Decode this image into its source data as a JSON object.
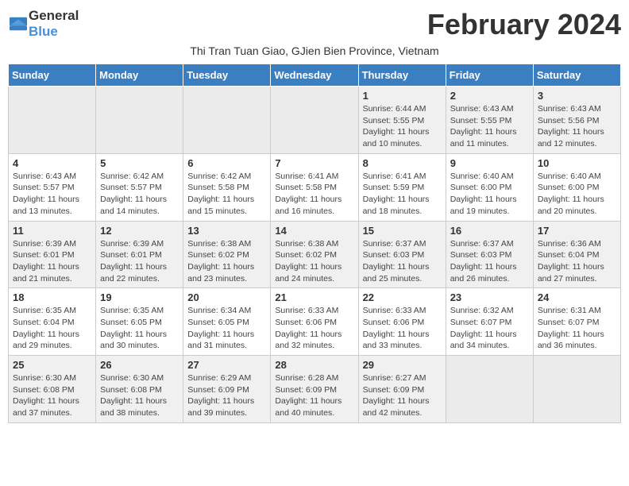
{
  "header": {
    "logo_general": "General",
    "logo_blue": "Blue",
    "title": "February 2024",
    "subtitle": "Thi Tran Tuan Giao, GJien Bien Province, Vietnam"
  },
  "days_of_week": [
    "Sunday",
    "Monday",
    "Tuesday",
    "Wednesday",
    "Thursday",
    "Friday",
    "Saturday"
  ],
  "weeks": [
    [
      {
        "day": "",
        "info": ""
      },
      {
        "day": "",
        "info": ""
      },
      {
        "day": "",
        "info": ""
      },
      {
        "day": "",
        "info": ""
      },
      {
        "day": "1",
        "info": "Sunrise: 6:44 AM\nSunset: 5:55 PM\nDaylight: 11 hours and 10 minutes."
      },
      {
        "day": "2",
        "info": "Sunrise: 6:43 AM\nSunset: 5:55 PM\nDaylight: 11 hours and 11 minutes."
      },
      {
        "day": "3",
        "info": "Sunrise: 6:43 AM\nSunset: 5:56 PM\nDaylight: 11 hours and 12 minutes."
      }
    ],
    [
      {
        "day": "4",
        "info": "Sunrise: 6:43 AM\nSunset: 5:57 PM\nDaylight: 11 hours and 13 minutes."
      },
      {
        "day": "5",
        "info": "Sunrise: 6:42 AM\nSunset: 5:57 PM\nDaylight: 11 hours and 14 minutes."
      },
      {
        "day": "6",
        "info": "Sunrise: 6:42 AM\nSunset: 5:58 PM\nDaylight: 11 hours and 15 minutes."
      },
      {
        "day": "7",
        "info": "Sunrise: 6:41 AM\nSunset: 5:58 PM\nDaylight: 11 hours and 16 minutes."
      },
      {
        "day": "8",
        "info": "Sunrise: 6:41 AM\nSunset: 5:59 PM\nDaylight: 11 hours and 18 minutes."
      },
      {
        "day": "9",
        "info": "Sunrise: 6:40 AM\nSunset: 6:00 PM\nDaylight: 11 hours and 19 minutes."
      },
      {
        "day": "10",
        "info": "Sunrise: 6:40 AM\nSunset: 6:00 PM\nDaylight: 11 hours and 20 minutes."
      }
    ],
    [
      {
        "day": "11",
        "info": "Sunrise: 6:39 AM\nSunset: 6:01 PM\nDaylight: 11 hours and 21 minutes."
      },
      {
        "day": "12",
        "info": "Sunrise: 6:39 AM\nSunset: 6:01 PM\nDaylight: 11 hours and 22 minutes."
      },
      {
        "day": "13",
        "info": "Sunrise: 6:38 AM\nSunset: 6:02 PM\nDaylight: 11 hours and 23 minutes."
      },
      {
        "day": "14",
        "info": "Sunrise: 6:38 AM\nSunset: 6:02 PM\nDaylight: 11 hours and 24 minutes."
      },
      {
        "day": "15",
        "info": "Sunrise: 6:37 AM\nSunset: 6:03 PM\nDaylight: 11 hours and 25 minutes."
      },
      {
        "day": "16",
        "info": "Sunrise: 6:37 AM\nSunset: 6:03 PM\nDaylight: 11 hours and 26 minutes."
      },
      {
        "day": "17",
        "info": "Sunrise: 6:36 AM\nSunset: 6:04 PM\nDaylight: 11 hours and 27 minutes."
      }
    ],
    [
      {
        "day": "18",
        "info": "Sunrise: 6:35 AM\nSunset: 6:04 PM\nDaylight: 11 hours and 29 minutes."
      },
      {
        "day": "19",
        "info": "Sunrise: 6:35 AM\nSunset: 6:05 PM\nDaylight: 11 hours and 30 minutes."
      },
      {
        "day": "20",
        "info": "Sunrise: 6:34 AM\nSunset: 6:05 PM\nDaylight: 11 hours and 31 minutes."
      },
      {
        "day": "21",
        "info": "Sunrise: 6:33 AM\nSunset: 6:06 PM\nDaylight: 11 hours and 32 minutes."
      },
      {
        "day": "22",
        "info": "Sunrise: 6:33 AM\nSunset: 6:06 PM\nDaylight: 11 hours and 33 minutes."
      },
      {
        "day": "23",
        "info": "Sunrise: 6:32 AM\nSunset: 6:07 PM\nDaylight: 11 hours and 34 minutes."
      },
      {
        "day": "24",
        "info": "Sunrise: 6:31 AM\nSunset: 6:07 PM\nDaylight: 11 hours and 36 minutes."
      }
    ],
    [
      {
        "day": "25",
        "info": "Sunrise: 6:30 AM\nSunset: 6:08 PM\nDaylight: 11 hours and 37 minutes."
      },
      {
        "day": "26",
        "info": "Sunrise: 6:30 AM\nSunset: 6:08 PM\nDaylight: 11 hours and 38 minutes."
      },
      {
        "day": "27",
        "info": "Sunrise: 6:29 AM\nSunset: 6:09 PM\nDaylight: 11 hours and 39 minutes."
      },
      {
        "day": "28",
        "info": "Sunrise: 6:28 AM\nSunset: 6:09 PM\nDaylight: 11 hours and 40 minutes."
      },
      {
        "day": "29",
        "info": "Sunrise: 6:27 AM\nSunset: 6:09 PM\nDaylight: 11 hours and 42 minutes."
      },
      {
        "day": "",
        "info": ""
      },
      {
        "day": "",
        "info": ""
      }
    ]
  ]
}
